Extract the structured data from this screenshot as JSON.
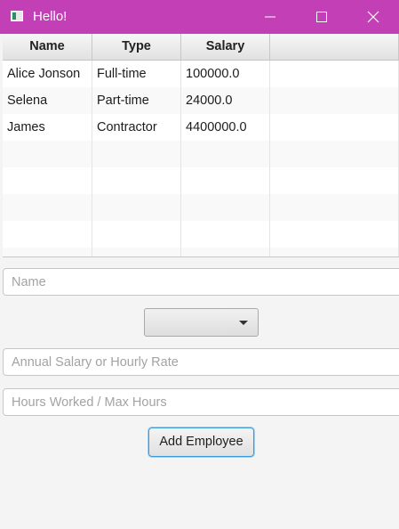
{
  "window": {
    "title": "Hello!",
    "icons": {
      "app": "app-window-icon",
      "minimize": "minimize-icon",
      "maximize": "maximize-icon",
      "close": "close-icon"
    },
    "titlebar_color": "#c23fb5"
  },
  "table": {
    "columns": [
      "Name",
      "Type",
      "Salary",
      ""
    ],
    "rows": [
      [
        "Alice Jonson",
        "Full-time",
        "100000.0"
      ],
      [
        "Selena",
        "Part-time",
        "24000.0"
      ],
      [
        "James",
        "Contractor",
        "4400000.0"
      ]
    ]
  },
  "form": {
    "name_placeholder": "Name",
    "type_selected": "",
    "salary_placeholder": "Annual Salary or Hourly Rate",
    "hours_placeholder": "Hours Worked / Max Hours",
    "add_button_label": "Add Employee"
  },
  "colors": {
    "focus_border": "#3b9ad9"
  }
}
